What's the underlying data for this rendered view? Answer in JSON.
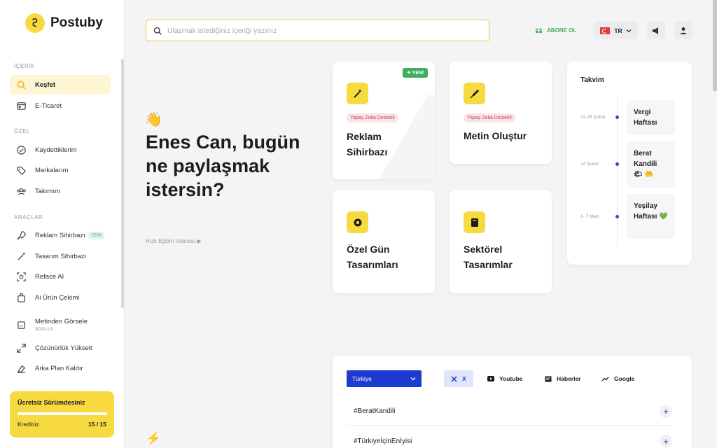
{
  "app": {
    "name": "Postuby"
  },
  "sidebar": {
    "sections": {
      "content": "İÇERİK",
      "private": "ÖZEL",
      "tools": "ARAÇLAR"
    },
    "items": {
      "kesfet": "Keşfet",
      "eticaret": "E-Ticaret",
      "kaydettiklerim": "Kaydettiklerim",
      "markalarim": "Markalarım",
      "takimim": "Takımım",
      "reklam": "Reklam Sihirbazı",
      "reklam_badge": "YENİ",
      "tasarim": "Tasarım Sihirbazı",
      "reface": "Reface AI",
      "urun": "Ai Ürün Çekimi",
      "metinden": "Metinden Görsele",
      "metinden_sub": "SDXL1.0",
      "cozunurluk": "Çözünürlük Yükselt",
      "arkaplan": "Arka Plan Kaldır"
    },
    "free_plan": {
      "title": "Ücretsiz Sürümdesiniz",
      "credit_label": "Krediniz",
      "credit_value": "15 / 15",
      "credit_fraction": 1.0
    }
  },
  "header": {
    "search_placeholder": "Ulaşmak istediğiniz içeriği yazınız",
    "subscribe": "ABONE OL",
    "language": "TR"
  },
  "greeting": {
    "text": "Enes Can, bugün ne paylaşmak istersin?",
    "video_link": "Hızlı Eğitim Videosu ▶"
  },
  "cards": {
    "reklam": {
      "tag": "✦ YENİ",
      "pill": "Yapay Zeka Destekli",
      "title": "Reklam Sihirbazı"
    },
    "metin": {
      "pill": "Yapay Zeka Destekli",
      "title": "Metin Oluştur"
    },
    "ozel": {
      "title": "Özel Gün Tasarımları"
    },
    "sektorel": {
      "title": "Sektörel Tasarımlar"
    }
  },
  "calendar": {
    "title": "Takvim",
    "events": [
      {
        "date": "22-28 Şubat",
        "name": "Vergi Haftası"
      },
      {
        "date": "24 Şubat",
        "name": "Berat Kandili �along 🤲"
      },
      {
        "date": "1- 7 Mart",
        "name": "Yeşilay Haftası 💚"
      }
    ]
  },
  "trends": {
    "country": "Türkiye",
    "tabs": {
      "x": "X",
      "youtube": "Youtube",
      "haberler": "Haberler",
      "google": "Google"
    },
    "rows": [
      "#BeratKandili",
      "#TürkiyeİçinEnİyisi"
    ]
  },
  "colors": {
    "accent": "#f7d940",
    "blue": "#1e3bd1",
    "green": "#3fae5c"
  }
}
